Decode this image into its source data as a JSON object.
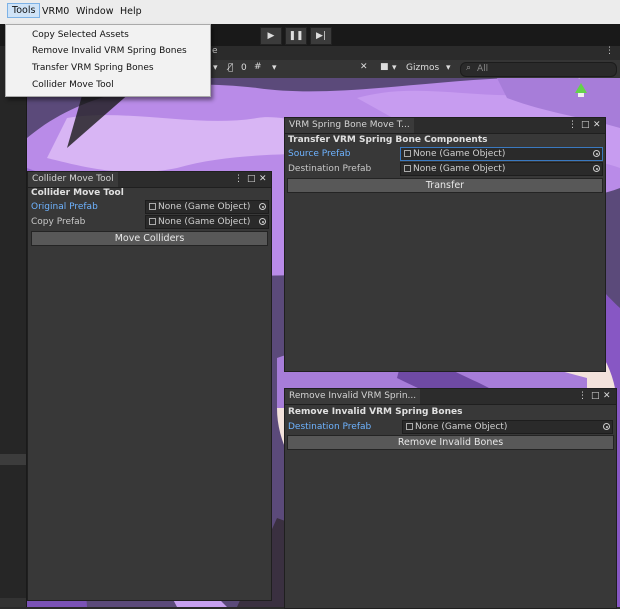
{
  "menubar": {
    "items": [
      "Tools",
      "VRM0",
      "Window",
      "Help"
    ],
    "active": "Tools"
  },
  "tools_menu": {
    "items": [
      "Copy Selected Assets",
      "Remove Invalid VRM Spring Bones",
      "Transfer VRM Spring Bones",
      "Collider Move Tool"
    ]
  },
  "scene_toolbar": {
    "gizmos": "Gizmos",
    "search_placeholder": "All",
    "hidden_count": "0",
    "axis_label": "y"
  },
  "collider_window": {
    "tab": "Collider Move Tool",
    "title": "Collider Move Tool",
    "original_label": "Original Prefab",
    "original_value": "None (Game Object)",
    "copy_label": "Copy Prefab",
    "copy_value": "None (Game Object)",
    "button": "Move Colliders"
  },
  "transfer_window": {
    "tab": "VRM Spring Bone Move T...",
    "title": "Transfer VRM Spring Bone Components",
    "source_label": "Source Prefab",
    "source_value": "None (Game Object)",
    "dest_label": "Destination Prefab",
    "dest_value": "None (Game Object)",
    "button": "Transfer"
  },
  "remove_window": {
    "tab": "Remove Invalid VRM Sprin...",
    "title": "Remove Invalid VRM Spring Bones",
    "dest_label": "Destination Prefab",
    "dest_value": "None (Game Object)",
    "button": "Remove Invalid Bones"
  },
  "colors": {
    "accent_blue": "#6eb3ff",
    "panel_bg": "#383838",
    "scene_purple": "#b98be8"
  }
}
